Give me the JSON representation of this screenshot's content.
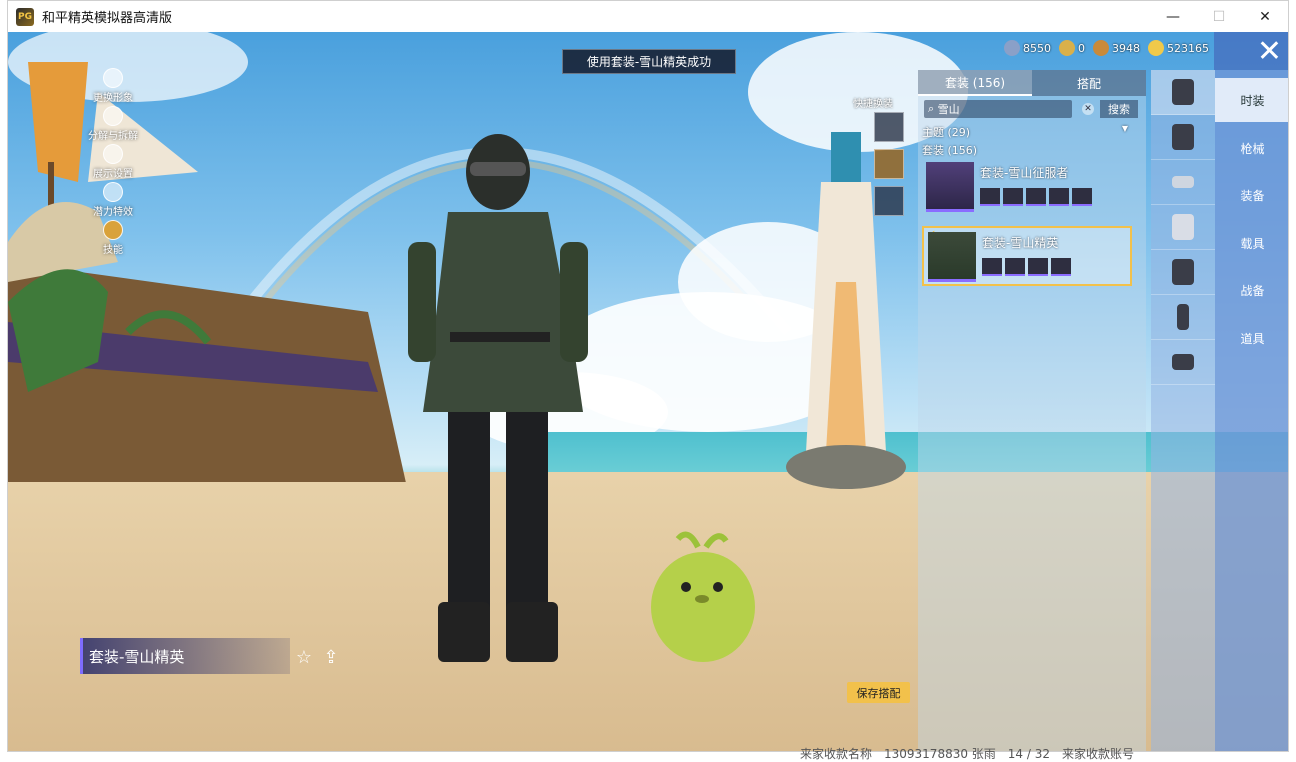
{
  "window": {
    "title": "和平精英模拟器高清版",
    "minimize": "—",
    "maximize": "☐",
    "close": "✕"
  },
  "toast": "使用套装-雪山精英成功",
  "currencies": [
    {
      "value": "8550",
      "color": "#8aa0c8"
    },
    {
      "value": "0",
      "color": "#d9b04a"
    },
    {
      "value": "3948",
      "color": "#c98a3a"
    },
    {
      "value": "523165",
      "color": "#f0c94a"
    }
  ],
  "close_label": "✕",
  "left_menu": [
    {
      "label": "更换形象"
    },
    {
      "label": "分解与拆解"
    },
    {
      "label": "展示设置"
    },
    {
      "label": "潜力特效"
    },
    {
      "label": "技能"
    }
  ],
  "quick_swap": {
    "label": "快捷换装"
  },
  "name_card": {
    "title": "套装-雪山精英"
  },
  "save_button": "保存搭配",
  "panel": {
    "tabs": [
      {
        "label": "套装 (156)",
        "active": true
      },
      {
        "label": "搭配",
        "active": false
      }
    ],
    "search": {
      "value": "雪山",
      "clear": "✕",
      "button": "搜索"
    },
    "theme_filter": "主题 (29)",
    "suit_count": "套装 (156)",
    "items": [
      {
        "name": "套装-雪山征服者",
        "selected": false,
        "check": ""
      },
      {
        "name": "套装-雪山精英",
        "selected": true,
        "check": "✓"
      }
    ]
  },
  "categories": [
    {
      "label": "时装",
      "active": true
    },
    {
      "label": "枪械",
      "active": false
    },
    {
      "label": "装备",
      "active": false
    },
    {
      "label": "载具",
      "active": false
    },
    {
      "label": "战备",
      "active": false
    },
    {
      "label": "道具",
      "active": false
    }
  ],
  "category_icons": [
    "coat-icon",
    "helmet-icon",
    "goggles-icon",
    "mask-icon",
    "jacket-icon",
    "pants-icon",
    "boots-icon"
  ],
  "background_text": "来家收款名称　13093178830 张雨　14 / 32　来家收款账号"
}
